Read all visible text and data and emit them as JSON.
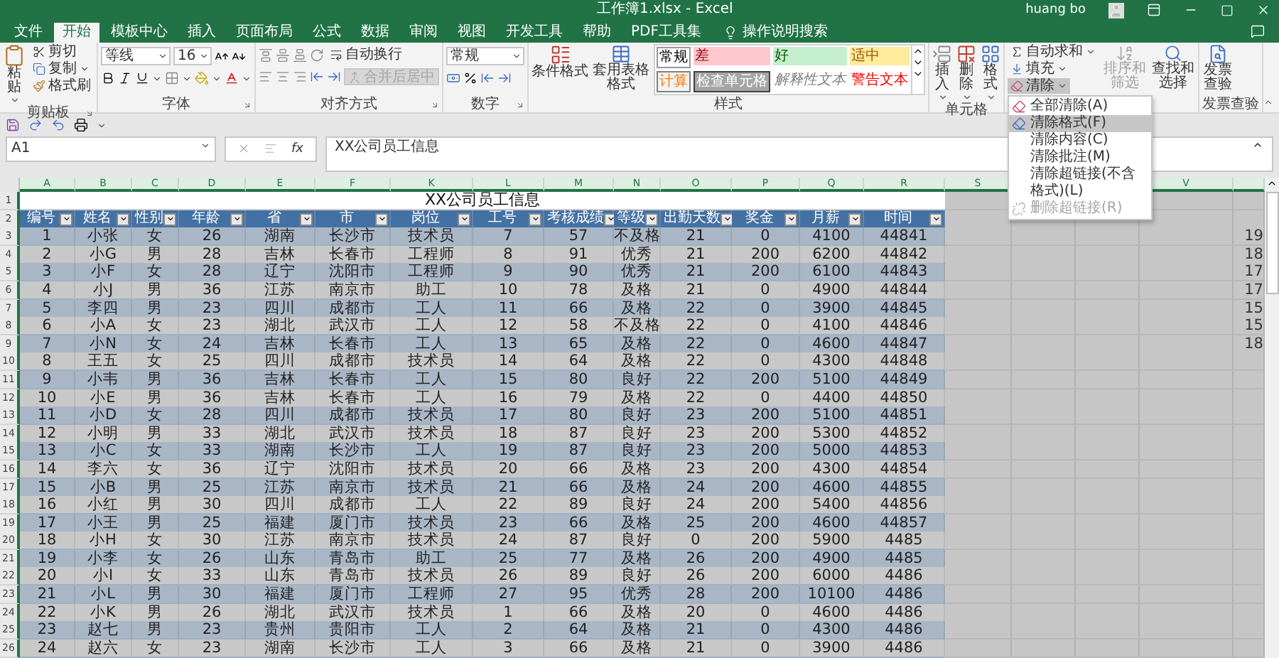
{
  "title_bar": {
    "title": "工作簿1.xlsx - Excel",
    "user": "huang bo"
  },
  "menu_tabs": [
    {
      "label": "文件",
      "selected": false
    },
    {
      "label": "开始",
      "selected": true
    },
    {
      "label": "模板中心",
      "selected": false
    },
    {
      "label": "插入",
      "selected": false
    },
    {
      "label": "页面布局",
      "selected": false
    },
    {
      "label": "公式",
      "selected": false
    },
    {
      "label": "数据",
      "selected": false
    },
    {
      "label": "审阅",
      "selected": false
    },
    {
      "label": "视图",
      "selected": false
    },
    {
      "label": "开发工具",
      "selected": false
    },
    {
      "label": "帮助",
      "selected": false
    },
    {
      "label": "PDF工具集",
      "selected": false
    }
  ],
  "tell_me": "操作说明搜索",
  "ribbon": {
    "clipboard": {
      "paste": "粘贴",
      "cut": "剪切",
      "copy": "复制",
      "format_painter": "格式刷",
      "label": "剪贴板"
    },
    "font": {
      "font_name": "等线",
      "font_size": "16",
      "label": "字体"
    },
    "alignment": {
      "wrap": "自动换行",
      "merge": {
        "label": "合并后居中",
        "disabled": true
      },
      "label": "对齐方式"
    },
    "number": {
      "format": "常规",
      "label": "数字"
    },
    "styles": {
      "conditional": "条件格式",
      "format_table": "套用表格格式",
      "label": "样式",
      "gallery": [
        {
          "kind": "normal",
          "label": "常规"
        },
        {
          "kind": "bad",
          "label": "差"
        },
        {
          "kind": "good",
          "label": "好"
        },
        {
          "kind": "neutral",
          "label": "适中"
        },
        {
          "kind": "calculation",
          "label": "计算"
        },
        {
          "kind": "check",
          "label": "检查单元格"
        },
        {
          "kind": "explanatory",
          "label": "解释性文本"
        },
        {
          "kind": "warning",
          "label": "警告文本"
        }
      ]
    },
    "cells": {
      "insert": "插入",
      "delete": "删除",
      "format": "格式",
      "label": "单元格"
    },
    "editing": {
      "autosum": "自动求和",
      "fill": "填充",
      "clear": {
        "label": "清除",
        "expanded": true
      },
      "sort": {
        "label": "排序和筛选",
        "disabled": true
      },
      "find": "查找和选择"
    },
    "invoice": {
      "button": "发票查验",
      "label": "发票查验"
    }
  },
  "clear_menu": [
    {
      "label": "全部清除(A)",
      "selected": false,
      "disabled": false
    },
    {
      "label": "清除格式(F)",
      "selected": true,
      "disabled": false
    },
    {
      "label": "清除内容(C)",
      "selected": false,
      "disabled": false
    },
    {
      "label": "清除批注(M)",
      "selected": false,
      "disabled": false
    },
    {
      "label": "清除超链接(不含格式)(L)",
      "selected": false,
      "disabled": false
    },
    {
      "label": "删除超链接(R)",
      "selected": false,
      "disabled": true
    }
  ],
  "formula_bar": {
    "name_box": "A1",
    "fx": "fx",
    "formula": "XX公司员工信息"
  },
  "sheet": {
    "columns": [
      "A",
      "B",
      "C",
      "D",
      "E",
      "F",
      "K",
      "L",
      "M",
      "N",
      "O",
      "P",
      "Q",
      "R",
      "S",
      null,
      null,
      "V",
      null
    ],
    "rows": [
      {
        "number": "1",
        "kind": "title",
        "text": "XX公司员工信息"
      },
      {
        "number": "2",
        "kind": "header",
        "cells": [
          "编号",
          "姓名",
          "性别",
          "年龄",
          "省",
          "市",
          "岗位",
          "工号",
          "考核成绩",
          "等级",
          "出勤天数",
          "奖金",
          "月薪",
          "时间"
        ]
      },
      {
        "number": "3",
        "kind": "data",
        "cells": [
          "1",
          "小张",
          "女",
          "26",
          "湖南",
          "长沙市",
          "技术员",
          "7",
          "57",
          "不及格",
          "21",
          "0",
          "4100",
          "44841"
        ],
        "side": "19"
      },
      {
        "number": "4",
        "kind": "data",
        "cells": [
          "2",
          "小G",
          "男",
          "28",
          "吉林",
          "长春市",
          "工程师",
          "8",
          "91",
          "优秀",
          "21",
          "200",
          "6200",
          "44842"
        ],
        "side": "18"
      },
      {
        "number": "5",
        "kind": "data",
        "cells": [
          "3",
          "小F",
          "女",
          "28",
          "辽宁",
          "沈阳市",
          "工程师",
          "9",
          "90",
          "优秀",
          "21",
          "200",
          "6100",
          "44843"
        ],
        "side": "17"
      },
      {
        "number": "6",
        "kind": "data",
        "cells": [
          "4",
          "小J",
          "男",
          "36",
          "江苏",
          "南京市",
          "助工",
          "10",
          "78",
          "及格",
          "21",
          "0",
          "4900",
          "44844"
        ],
        "side": "17"
      },
      {
        "number": "7",
        "kind": "data",
        "cells": [
          "5",
          "李四",
          "男",
          "23",
          "四川",
          "成都市",
          "工人",
          "11",
          "66",
          "及格",
          "22",
          "0",
          "3900",
          "44845"
        ],
        "side": "15"
      },
      {
        "number": "8",
        "kind": "data",
        "cells": [
          "6",
          "小A",
          "女",
          "23",
          "湖北",
          "武汉市",
          "工人",
          "12",
          "58",
          "不及格",
          "22",
          "0",
          "4100",
          "44846"
        ],
        "side": "15"
      },
      {
        "number": "9",
        "kind": "data",
        "cells": [
          "7",
          "小N",
          "女",
          "24",
          "吉林",
          "长春市",
          "工人",
          "13",
          "65",
          "及格",
          "22",
          "0",
          "4600",
          "44847"
        ],
        "side": "18"
      },
      {
        "number": "10",
        "kind": "data",
        "cells": [
          "8",
          "王五",
          "女",
          "25",
          "四川",
          "成都市",
          "技术员",
          "14",
          "64",
          "及格",
          "22",
          "0",
          "4300",
          "44848"
        ]
      },
      {
        "number": "11",
        "kind": "data",
        "cells": [
          "9",
          "小韦",
          "男",
          "36",
          "吉林",
          "长春市",
          "工人",
          "15",
          "80",
          "良好",
          "22",
          "200",
          "5100",
          "44849"
        ]
      },
      {
        "number": "12",
        "kind": "data",
        "cells": [
          "10",
          "小E",
          "男",
          "36",
          "吉林",
          "长春市",
          "工人",
          "16",
          "79",
          "及格",
          "22",
          "0",
          "4400",
          "44850"
        ]
      },
      {
        "number": "13",
        "kind": "data",
        "cells": [
          "11",
          "小D",
          "女",
          "28",
          "四川",
          "成都市",
          "技术员",
          "17",
          "80",
          "良好",
          "23",
          "200",
          "5100",
          "44851"
        ]
      },
      {
        "number": "14",
        "kind": "data",
        "cells": [
          "12",
          "小明",
          "男",
          "33",
          "湖北",
          "武汉市",
          "技术员",
          "18",
          "87",
          "良好",
          "23",
          "200",
          "5300",
          "44852"
        ]
      },
      {
        "number": "15",
        "kind": "data",
        "cells": [
          "13",
          "小C",
          "女",
          "33",
          "湖南",
          "长沙市",
          "工人",
          "19",
          "87",
          "良好",
          "23",
          "200",
          "5000",
          "44853"
        ]
      },
      {
        "number": "16",
        "kind": "data",
        "cells": [
          "14",
          "李六",
          "女",
          "36",
          "辽宁",
          "沈阳市",
          "技术员",
          "20",
          "66",
          "及格",
          "23",
          "200",
          "4300",
          "44854"
        ]
      },
      {
        "number": "17",
        "kind": "data",
        "cells": [
          "15",
          "小B",
          "男",
          "25",
          "江苏",
          "南京市",
          "技术员",
          "21",
          "66",
          "及格",
          "24",
          "200",
          "4600",
          "44855"
        ]
      },
      {
        "number": "18",
        "kind": "data",
        "cells": [
          "16",
          "小红",
          "男",
          "30",
          "四川",
          "成都市",
          "工人",
          "22",
          "89",
          "良好",
          "24",
          "200",
          "5400",
          "44856"
        ]
      },
      {
        "number": "19",
        "kind": "data",
        "cells": [
          "17",
          "小王",
          "男",
          "25",
          "福建",
          "厦门市",
          "技术员",
          "23",
          "66",
          "及格",
          "25",
          "200",
          "4600",
          "44857"
        ]
      },
      {
        "number": "20",
        "kind": "data",
        "cells": [
          "18",
          "小H",
          "女",
          "30",
          "江苏",
          "南京市",
          "技术员",
          "24",
          "87",
          "良好",
          "0",
          "200",
          "5900",
          "4485"
        ]
      },
      {
        "number": "21",
        "kind": "data",
        "cells": [
          "19",
          "小李",
          "女",
          "26",
          "山东",
          "青岛市",
          "助工",
          "25",
          "77",
          "及格",
          "26",
          "200",
          "4900",
          "4485"
        ]
      },
      {
        "number": "22",
        "kind": "data",
        "cells": [
          "20",
          "小I",
          "女",
          "33",
          "山东",
          "青岛市",
          "技术员",
          "26",
          "89",
          "良好",
          "26",
          "200",
          "6000",
          "4486"
        ]
      },
      {
        "number": "23",
        "kind": "data",
        "cells": [
          "21",
          "小L",
          "男",
          "30",
          "福建",
          "厦门市",
          "工程师",
          "27",
          "95",
          "优秀",
          "28",
          "200",
          "10100",
          "4486"
        ]
      },
      {
        "number": "24",
        "kind": "data",
        "cells": [
          "22",
          "小K",
          "男",
          "26",
          "湖北",
          "武汉市",
          "技术员",
          "1",
          "66",
          "及格",
          "20",
          "0",
          "4600",
          "4486"
        ]
      },
      {
        "number": "25",
        "kind": "data",
        "cells": [
          "23",
          "赵七",
          "男",
          "23",
          "贵州",
          "贵阳市",
          "工人",
          "2",
          "64",
          "及格",
          "21",
          "0",
          "4300",
          "4486"
        ]
      },
      {
        "number": "26",
        "kind": "data",
        "cells": [
          "24",
          "赵六",
          "女",
          "23",
          "湖南",
          "长沙市",
          "工人",
          "3",
          "66",
          "及格",
          "21",
          "0",
          "3900",
          "4486"
        ]
      }
    ]
  }
}
